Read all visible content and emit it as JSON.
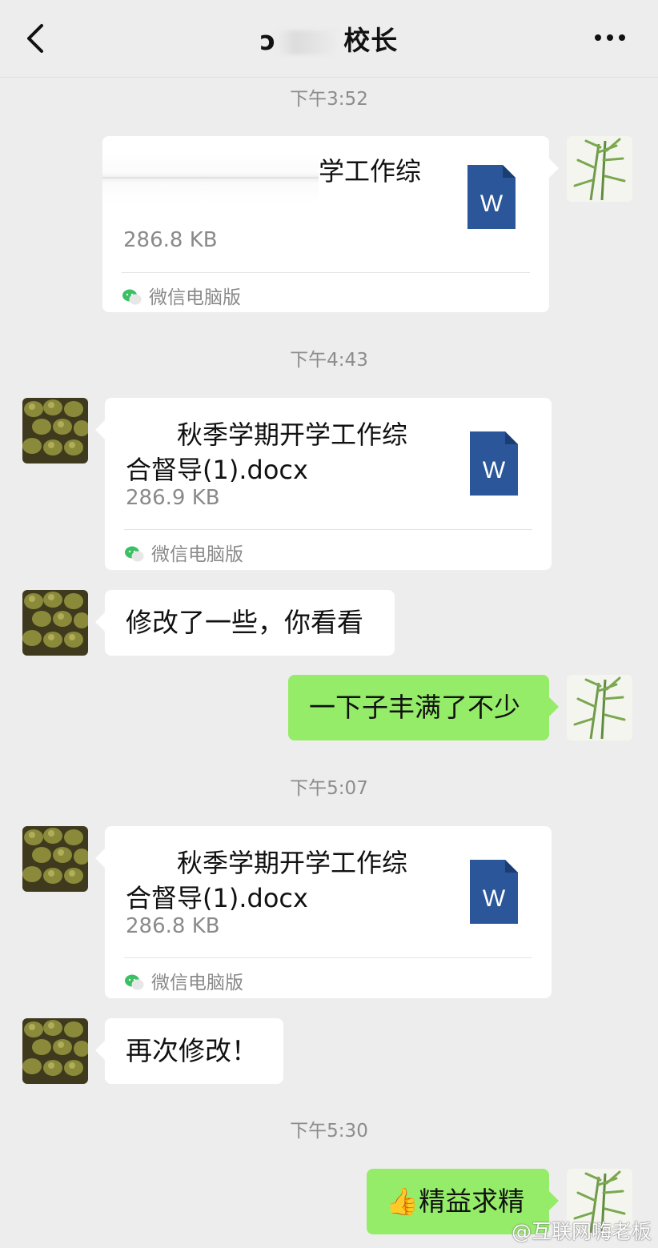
{
  "header": {
    "title_visible": "ɔ",
    "title_tail": "校长"
  },
  "messages": [
    {
      "time": "下午3:52"
    },
    {
      "side": "right",
      "type": "file",
      "file_name_visible": "学工作综",
      "file_size": "286.8 KB",
      "source": "微信电脑版"
    },
    {
      "time": "下午4:43"
    },
    {
      "side": "left",
      "type": "file",
      "file_name": "秋季学期开学工作综合督导(1).docx",
      "file_name_line1": "秋季学期开学工作综",
      "file_name_line2": "合督导(1).docx",
      "file_size": "286.9 KB",
      "source": "微信电脑版"
    },
    {
      "side": "left",
      "type": "text",
      "text": "修改了一些，你看看"
    },
    {
      "side": "right",
      "type": "text",
      "text": "一下子丰满了不少"
    },
    {
      "time": "下午5:07"
    },
    {
      "side": "left",
      "type": "file",
      "file_name_line1": "秋季学期开学工作综",
      "file_name_line2": "合督导(1).docx",
      "file_size": "286.8 KB",
      "source": "微信电脑版"
    },
    {
      "side": "left",
      "type": "text",
      "text": "再次修改！"
    },
    {
      "time": "下午5:30"
    },
    {
      "side": "right",
      "type": "text",
      "text": "精益求精",
      "emoji": "👍"
    }
  ],
  "watermark": "@互联网嗨老板",
  "colors": {
    "background": "#ededed",
    "own_bubble": "#95ec69",
    "other_bubble": "#ffffff",
    "word_icon": "#2b579a",
    "meta_text": "#8a8a8a"
  },
  "icons": {
    "back": "chevron-left-icon",
    "more": "more-dots-icon",
    "file": "word-doc-icon",
    "source": "wechat-icon",
    "own_avatar": "bamboo-avatar",
    "other_avatar": "kiwi-fruit-avatar"
  }
}
